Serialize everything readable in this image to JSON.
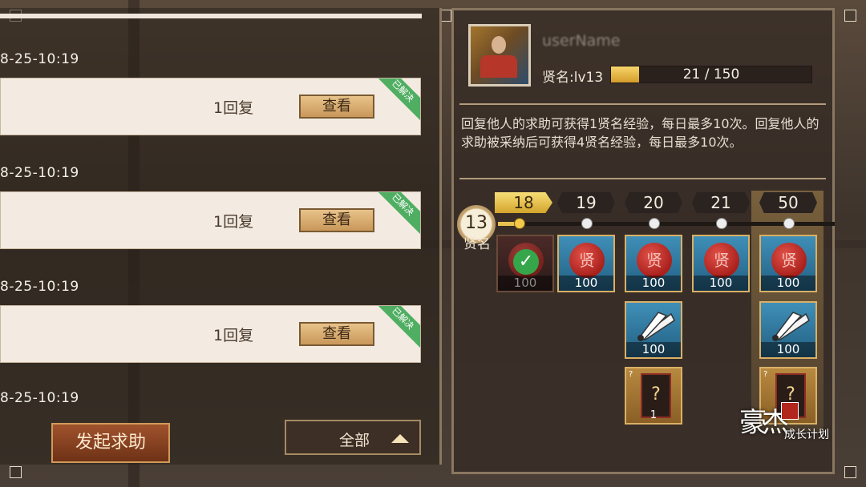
{
  "requests": [
    {
      "date": "8-25-10:19",
      "reply": "1回复",
      "view_label": "查看",
      "ribbon": "已解决"
    },
    {
      "date": "8-25-10:19",
      "reply": "1回复",
      "view_label": "查看",
      "ribbon": "已解决"
    },
    {
      "date": "8-25-10:19",
      "reply": "1回复",
      "view_label": "查看",
      "ribbon": "已解决"
    },
    {
      "date": "8-25-10:19"
    }
  ],
  "footer": {
    "start_help_label": "发起求助",
    "filter_label": "全部"
  },
  "profile": {
    "username": "userName",
    "fame_label": "贤名:lv13",
    "exp_current": 21,
    "exp_max": 150,
    "exp_text": "21 / 150"
  },
  "description": "回复他人的求助可获得1贤名经验，每日最多10次。回复他人的求助被采纳后可获得4贤名经验，每日最多10次。",
  "levels": {
    "current": {
      "value": "13",
      "label": "贤名"
    },
    "badges": [
      "18",
      "19",
      "20",
      "21",
      "50"
    ]
  },
  "rewards": {
    "row1": [
      "100",
      "100",
      "100",
      "100",
      "100"
    ],
    "seal_char": "贤",
    "row2": [
      "100",
      "100"
    ],
    "row3": [
      "1"
    ],
    "check": "✓",
    "card_mark": "?",
    "card_corner": "?"
  },
  "logo": {
    "main": "豪杰",
    "sub": "成长计划"
  },
  "colors": {
    "accent": "#e8c24e",
    "ribbon": "#4fae62",
    "panel_border": "#8a7760"
  }
}
